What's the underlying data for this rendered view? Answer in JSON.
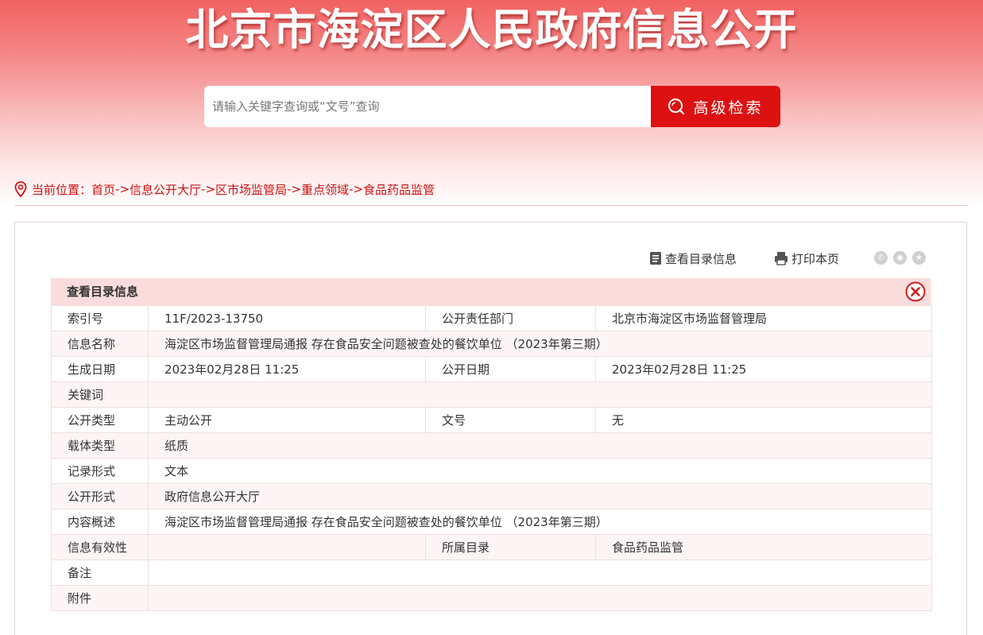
{
  "banner": {
    "title": "北京市海淀区人民政府信息公开"
  },
  "search": {
    "placeholder": "请输入关键字查询或“文号”查询",
    "button_label": "高级检索"
  },
  "breadcrumb": {
    "prefix": "当前位置：",
    "items": [
      "首页",
      "信息公开大厅",
      "区市场监管局",
      "重点领域",
      "食品药品监管"
    ],
    "separator": "->"
  },
  "tools": {
    "catalog_label": "查看目录信息",
    "print_label": "打印本页",
    "share_icons": [
      "wechat-icon",
      "weibo-icon",
      "star-icon"
    ]
  },
  "info": {
    "header_title": "查看目录信息",
    "rows": [
      {
        "l1": "索引号",
        "v1": "11F/2023-13750",
        "l2": "公开责任部门",
        "v2": "北京市海淀区市场监督管理局"
      },
      {
        "l1": "信息名称",
        "v1": "海淀区市场监督管理局通报 存在食品安全问题被查处的餐饮单位 （2023年第三期）"
      },
      {
        "l1": "生成日期",
        "v1": "2023年02月28日 11:25",
        "l2": "公开日期",
        "v2": "2023年02月28日 11:25"
      },
      {
        "l1": "关键词",
        "v1": ""
      },
      {
        "l1": "公开类型",
        "v1": "主动公开",
        "l2": "文号",
        "v2": "无"
      },
      {
        "l1": "载体类型",
        "v1": "纸质"
      },
      {
        "l1": "记录形式",
        "v1": "文本"
      },
      {
        "l1": "公开形式",
        "v1": "政府信息公开大厅"
      },
      {
        "l1": "内容概述",
        "v1": "海淀区市场监督管理局通报 存在食品安全问题被查处的餐饮单位 （2023年第三期）"
      },
      {
        "l1": "信息有效性",
        "v1": "",
        "l2": "所属目录",
        "v2": "食品药品监管"
      },
      {
        "l1": "备注",
        "v1": ""
      },
      {
        "l1": "附件",
        "v1": ""
      }
    ]
  },
  "colors": {
    "accent": "#dd1111",
    "header_bg": "#fbdcdc",
    "breadcrumb": "#cc1111"
  }
}
